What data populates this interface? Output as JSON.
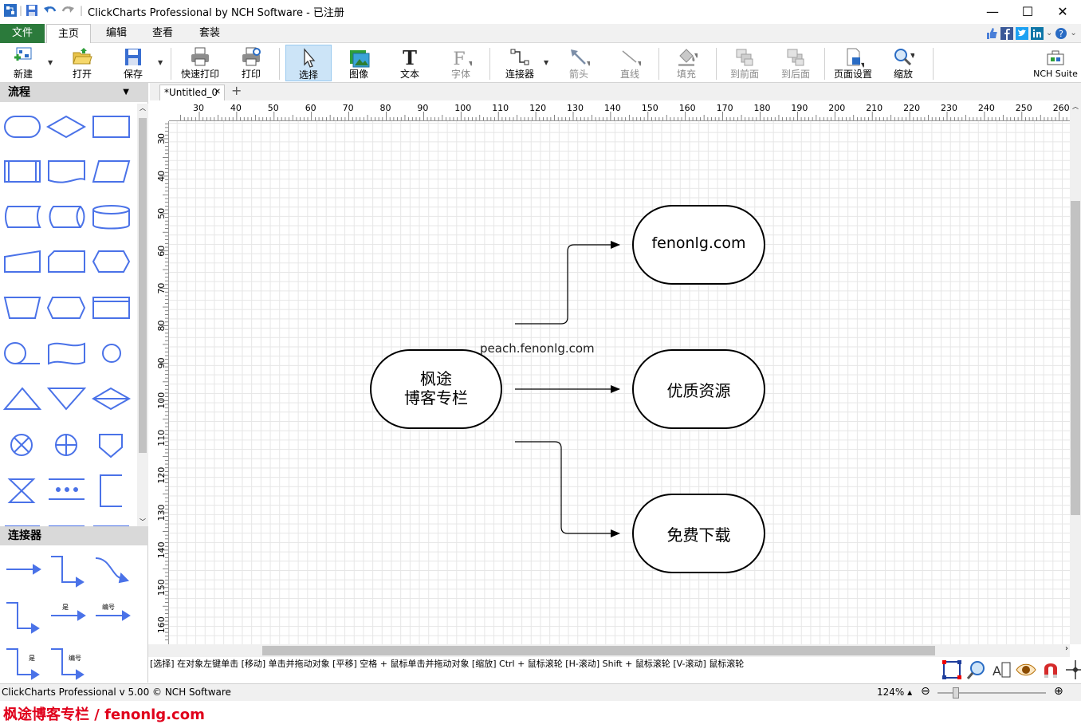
{
  "window": {
    "title": "ClickCharts Professional by NCH Software - 已注册",
    "minimize": "—",
    "maximize": "☐",
    "close": "✕"
  },
  "menu": {
    "file": "文件",
    "tabs": [
      "主页",
      "编辑",
      "查看",
      "套装"
    ]
  },
  "toolbar": {
    "new": "新建",
    "open": "打开",
    "save": "保存",
    "quick_print": "快速打印",
    "print": "打印",
    "select": "选择",
    "image": "图像",
    "text": "文本",
    "font": "字体",
    "connector": "连接器",
    "arrow": "箭头",
    "line": "直线",
    "fill": "填充",
    "to_front": "到前面",
    "to_back": "到后面",
    "page_setup": "页面设置",
    "zoom": "缩放",
    "nch_suite": "NCH Suite"
  },
  "left_panel": {
    "shapes_header": "流程",
    "connectors_header": "连接器",
    "connector_labels": {
      "yes": "是",
      "number": "编号"
    }
  },
  "document": {
    "tab": "*Untitled_0",
    "close": "✕",
    "add": "+"
  },
  "rulers": {
    "horizontal": [
      "30",
      "40",
      "50",
      "60",
      "70",
      "80",
      "90",
      "100",
      "110",
      "120",
      "130",
      "140",
      "150",
      "160",
      "170",
      "180",
      "190",
      "200",
      "210",
      "220",
      "230",
      "240",
      "250",
      "260"
    ],
    "vertical": [
      "30",
      "40",
      "50",
      "60",
      "70",
      "80",
      "90",
      "100",
      "110",
      "120",
      "130",
      "140",
      "150",
      "160"
    ]
  },
  "diagram": {
    "center_line1": "枫途",
    "center_line2": "博客专栏",
    "node_top": "fenonlg.com",
    "node_mid": "优质资源",
    "node_bottom": "免费下载",
    "floating_label": "peach.fenonlg.com"
  },
  "hint": "[选择] 在对象左键单击 [移动] 单击并拖动对象 [平移] 空格 + 鼠标单击并拖动对象 [缩放] Ctrl + 鼠标滚轮 [H-滚动] Shift + 鼠标滚轮 [V-滚动] 鼠标滚轮",
  "status": {
    "text": "ClickCharts Professional v 5.00 © NCH Software",
    "zoom": "124% ▴"
  },
  "watermark": "枫途博客专栏 / fenonlg.com",
  "colors": {
    "file_menu_bg": "#2b7a3b",
    "shape_stroke": "#4a72e8",
    "watermark": "#e0001b"
  }
}
